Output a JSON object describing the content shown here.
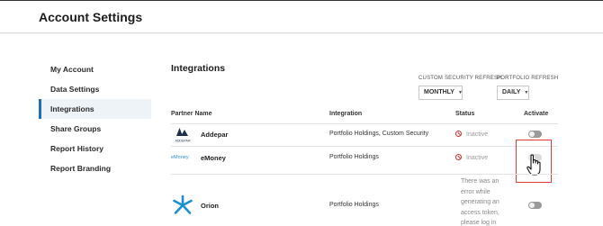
{
  "header": {
    "title": "Account Settings"
  },
  "sidebar": {
    "items": [
      {
        "label": "My Account",
        "active": false
      },
      {
        "label": "Data Settings",
        "active": false
      },
      {
        "label": "Integrations",
        "active": true
      },
      {
        "label": "Share Groups",
        "active": false
      },
      {
        "label": "Report History",
        "active": false
      },
      {
        "label": "Report Branding",
        "active": false
      }
    ]
  },
  "integrations": {
    "title": "Integrations",
    "custom_refresh_label": "CUSTOM SECURITY REFRESH",
    "custom_refresh_value": "MONTHLY",
    "portfolio_refresh_label": "PORTFOLIO REFRESH",
    "portfolio_refresh_value": "DAILY",
    "columns": {
      "partner": "Partner Name",
      "integration": "Integration",
      "status": "Status",
      "activate": "Activate"
    },
    "rows": [
      {
        "logo_text": "ADDEPAR",
        "partner": "Addepar",
        "integration": "Portfolio Holdings, Custom Security",
        "status": "Inactive",
        "activated": false
      },
      {
        "logo_text": "eMoney",
        "partner": "eMoney",
        "integration": "Portfolio Holdings",
        "status": "Inactive",
        "activated": false
      },
      {
        "partner": "Orion",
        "integration": "Portfolio Holdings",
        "status_lines": [
          "There was an",
          "error while",
          "generating an",
          "access token,",
          "please log in"
        ],
        "activated": false
      }
    ]
  },
  "colors": {
    "accent": "#1f6fb5",
    "error": "#d32f2f",
    "highlight": "#e23a3a",
    "orion": "#1c8fd0"
  },
  "icons": {
    "inactive_status": "no-entry-icon",
    "cursor": "hand-pointer-icon",
    "select_caret": "caret-down-icon"
  }
}
